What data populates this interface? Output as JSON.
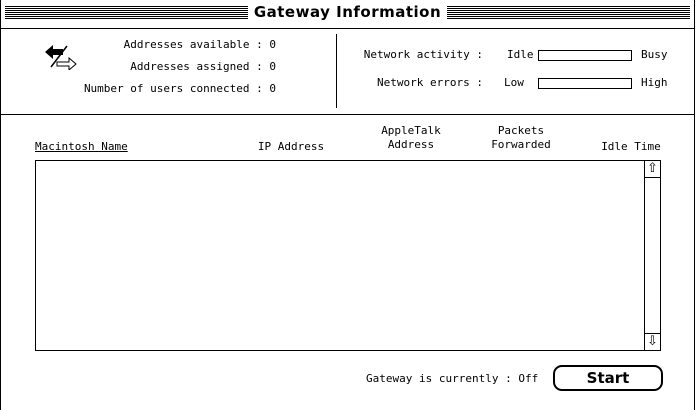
{
  "window": {
    "title": "Gateway Information"
  },
  "stats": {
    "addresses_available": "Addresses available : 0",
    "addresses_assigned": "Addresses assigned : 0",
    "users_connected": "Number of users connected : 0"
  },
  "meters": {
    "activity_label": "Network activity :",
    "activity_low": "Idle",
    "activity_high": "Busy",
    "activity_level": 0,
    "errors_label": "Network errors :",
    "errors_low": "Low",
    "errors_high": "High",
    "errors_level": 0
  },
  "table": {
    "columns": [
      {
        "label": "Macintosh Name"
      },
      {
        "label": "IP Address"
      },
      {
        "label": "AppleTalk\nAddress"
      },
      {
        "label": "Packets\nForwarded"
      },
      {
        "label": "Idle Time"
      }
    ],
    "rows": []
  },
  "footer": {
    "status": "Gateway is currently : Off",
    "start_label": "Start"
  }
}
